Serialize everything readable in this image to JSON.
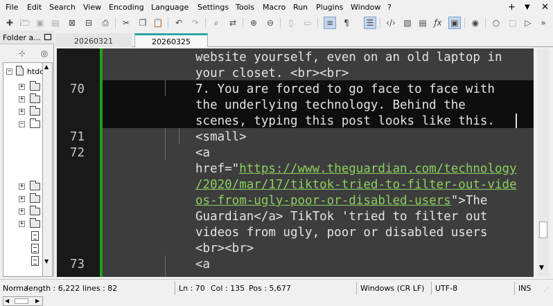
{
  "menubar": {
    "items": [
      "File",
      "Edit",
      "Search",
      "View",
      "Encoding",
      "Language",
      "Settings",
      "Tools",
      "Macro",
      "Run",
      "Plugins",
      "Window",
      "?"
    ],
    "window_controls": [
      "+",
      "▼",
      "✕"
    ]
  },
  "toolbar": {
    "icons": [
      "new-file-icon",
      "open-file-icon",
      "save-icon",
      "save-all-icon",
      "close-icon",
      "close-all-icon",
      "print-icon",
      "cut-icon",
      "copy-icon",
      "paste-icon",
      "undo-icon",
      "redo-icon",
      "find-icon",
      "replace-icon",
      "zoom-in-icon",
      "zoom-out-icon",
      "sync-vertical-icon",
      "sync-horizontal-icon",
      "word-wrap-icon",
      "show-all-chars-icon",
      "indent-guide-icon",
      "language-icon",
      "document-map-icon",
      "document-list-icon",
      "function-list-icon",
      "folder-as-workspace-icon",
      "monitoring-icon",
      "record-macro-icon",
      "stop-macro-icon",
      "play-macro-icon",
      "run-macro-multiple-icon",
      "save-macro-icon"
    ]
  },
  "folder_panel": {
    "title": "Folder a...",
    "root_label": "htdo"
  },
  "tabs": [
    {
      "label": "20260321",
      "active": false
    },
    {
      "label": "20260325",
      "active": true
    }
  ],
  "editor": {
    "lines": [
      {
        "num": "",
        "text": "website yourself, even on an old laptop in"
      },
      {
        "num": "",
        "text": "your closet. <br><br>"
      },
      {
        "num": "70",
        "text": "7. You are forced to go face to face with"
      },
      {
        "num": "",
        "text": "the underlying technology. Behind the"
      },
      {
        "num": "",
        "text": "scenes, typing this post looks like this."
      },
      {
        "num": "71",
        "text": "<small>"
      },
      {
        "num": "72",
        "text": "<a"
      },
      {
        "num": "",
        "pre": "href=\"",
        "link": "https://www.theguardian.com/technology",
        "post": ""
      },
      {
        "num": "",
        "pre": "",
        "link": "/2020/mar/17/tiktok-tried-to-filter-out-vide",
        "post": ""
      },
      {
        "num": "",
        "pre": "",
        "link": "os-from-ugly-poor-or-disabled-users",
        "post": "\">The"
      },
      {
        "num": "",
        "text": "Guardian</a> TikTok 'tried to filter out"
      },
      {
        "num": "",
        "text": "videos from ugly, poor or disabled users"
      },
      {
        "num": "",
        "text": "<br><br>"
      },
      {
        "num": "73",
        "text": "<a"
      }
    ]
  },
  "statusbar": {
    "type": "Norma",
    "length": "length : 6,222",
    "lines": "lines : 82",
    "ln": "Ln : 70",
    "col": "Col : 135",
    "pos": "Pos : 5,677",
    "eol": "Windows (CR LF)",
    "encoding": "UTF-8",
    "mode": "INS"
  }
}
